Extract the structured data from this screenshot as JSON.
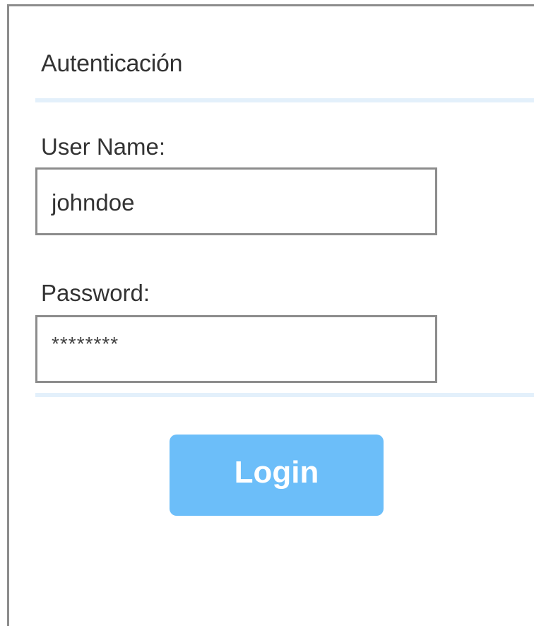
{
  "form": {
    "title": "Autenticación",
    "username": {
      "label": "User Name:",
      "value": "johndoe"
    },
    "password": {
      "label": "Password:",
      "value": "********"
    },
    "login_label": "Login"
  },
  "colors": {
    "accent": "#6cbef9",
    "divider": "#e3f0fb",
    "border": "#8c8c8c",
    "text": "#333333"
  }
}
